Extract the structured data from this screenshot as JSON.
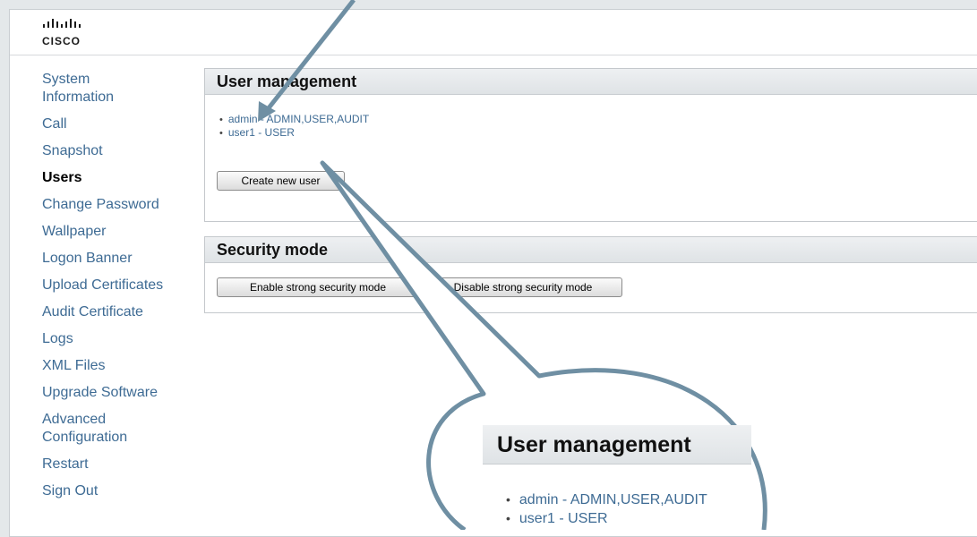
{
  "logo": {
    "name": "cisco-logo-icon",
    "text": "CISCO",
    "bars": "·ı|ı·ı|ı·"
  },
  "sidebar": {
    "items": [
      {
        "label": "System Information",
        "active": false
      },
      {
        "label": "Call",
        "active": false
      },
      {
        "label": "Snapshot",
        "active": false
      },
      {
        "label": "Users",
        "active": true
      },
      {
        "label": "Change Password",
        "active": false
      },
      {
        "label": "Wallpaper",
        "active": false
      },
      {
        "label": "Logon Banner",
        "active": false
      },
      {
        "label": "Upload Certificates",
        "active": false
      },
      {
        "label": "Audit Certificate",
        "active": false
      },
      {
        "label": "Logs",
        "active": false
      },
      {
        "label": "XML Files",
        "active": false
      },
      {
        "label": "Upgrade Software",
        "active": false
      },
      {
        "label": "Advanced Configuration",
        "active": false
      },
      {
        "label": "Restart",
        "active": false
      },
      {
        "label": "Sign Out",
        "active": false
      }
    ]
  },
  "user_management": {
    "title": "User management",
    "users": [
      {
        "label": "admin - ADMIN,USER,AUDIT"
      },
      {
        "label": "user1 - USER"
      }
    ],
    "create_button": "Create new user"
  },
  "security_mode": {
    "title": "Security mode",
    "enable_button": "Enable strong security mode",
    "disable_button": "Disable strong security mode"
  },
  "zoom": {
    "title": "User management",
    "users": [
      {
        "label": "admin - ADMIN,USER,AUDIT"
      },
      {
        "label": "user1 - USER"
      }
    ]
  },
  "colors": {
    "link": "#3e6b94",
    "callout": "#6f8fa3"
  }
}
